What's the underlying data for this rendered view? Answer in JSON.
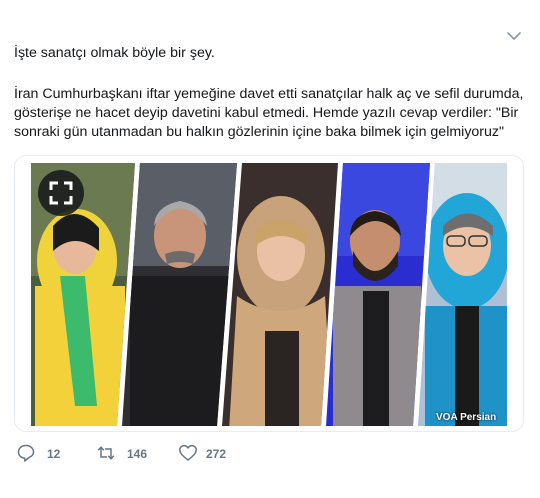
{
  "tweet": {
    "first_line": "İşte sanatçı olmak böyle bir şey.",
    "body": "İran Cumhurbaşkanı iftar yemeğine davet etti sanatçılar halk aç ve sefil durumda, gösterişe ne hacet deyip davetini kabul etmedi. Hemde yazılı cevap verdiler: \"Bir sonraki gün utanmadan bu halkın gözlerinin içine baka bilmek için gelmiyoruz\""
  },
  "media": {
    "watermark": "VOA Persian",
    "expand_icon": "expand-icon",
    "photos": [
      "person-yellow-scarf",
      "person-gray-hair",
      "person-blonde-scarf",
      "person-bearded",
      "person-blue-scarf"
    ]
  },
  "actions": {
    "reply": {
      "icon": "reply-icon",
      "count": "12"
    },
    "retweet": {
      "icon": "retweet-icon",
      "count": "146"
    },
    "like": {
      "icon": "heart-icon",
      "count": "272"
    }
  },
  "menu": {
    "icon": "chevron-down-icon"
  },
  "colors": {
    "text": "#14171a",
    "muted": "#657786",
    "border": "#e6ecf0"
  }
}
